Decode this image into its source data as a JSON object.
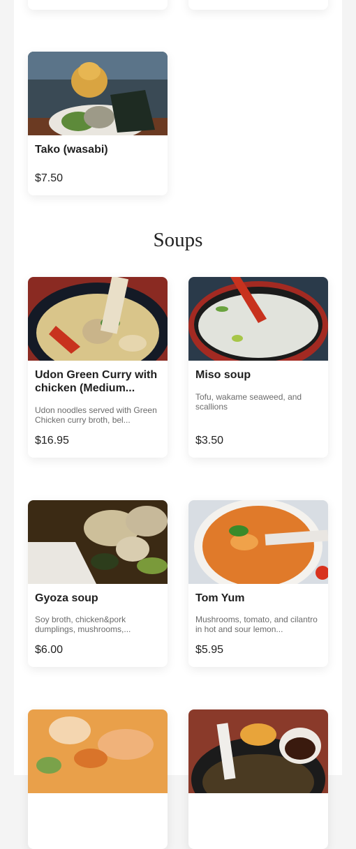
{
  "sections": [
    {
      "title": "",
      "items": [
        {
          "name": "Tako (wasabi)",
          "description": "",
          "price": "$7.50"
        }
      ]
    },
    {
      "title": "Soups",
      "items": [
        {
          "name": "Udon Green Curry with chicken (Medium...",
          "description": "Udon noodles served with Green Chicken curry broth, bel...",
          "price": "$16.95"
        },
        {
          "name": "Miso soup",
          "description": "Tofu, wakame seaweed, and scallions",
          "price": "$3.50"
        },
        {
          "name": "Gyoza soup",
          "description": "Soy broth, chicken&pork dumplings, mushrooms,...",
          "price": "$6.00"
        },
        {
          "name": "Tom Yum",
          "description": "Mushrooms, tomato, and cilantro in hot and sour lemon...",
          "price": "$5.95"
        }
      ]
    }
  ]
}
